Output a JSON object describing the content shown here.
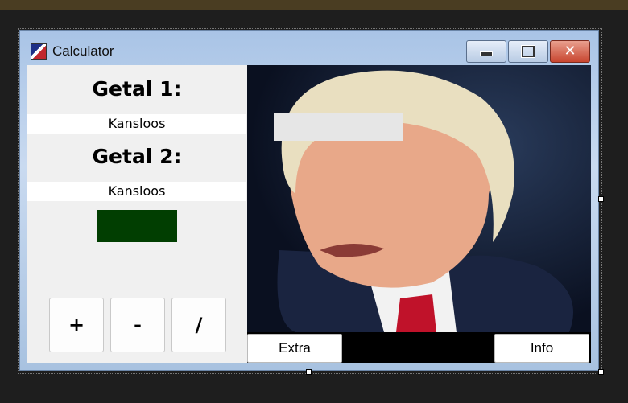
{
  "window": {
    "title": "Calculator"
  },
  "icons": {
    "app": "app-flag-icon",
    "minimize": "minimize-icon",
    "maximize": "maximize-icon",
    "close": "close-icon"
  },
  "form": {
    "label1": "Getal 1:",
    "input1": "Kansloos",
    "label2": "Getal 2:",
    "input2": "Kansloos"
  },
  "operators": {
    "plus": "+",
    "minus": "-",
    "divide": "/"
  },
  "buttons": {
    "extra": "Extra",
    "info": "Info"
  },
  "colors": {
    "result_box": "#013e01",
    "close_button": "#c8452f",
    "titlebar": "#a9c4e6"
  }
}
